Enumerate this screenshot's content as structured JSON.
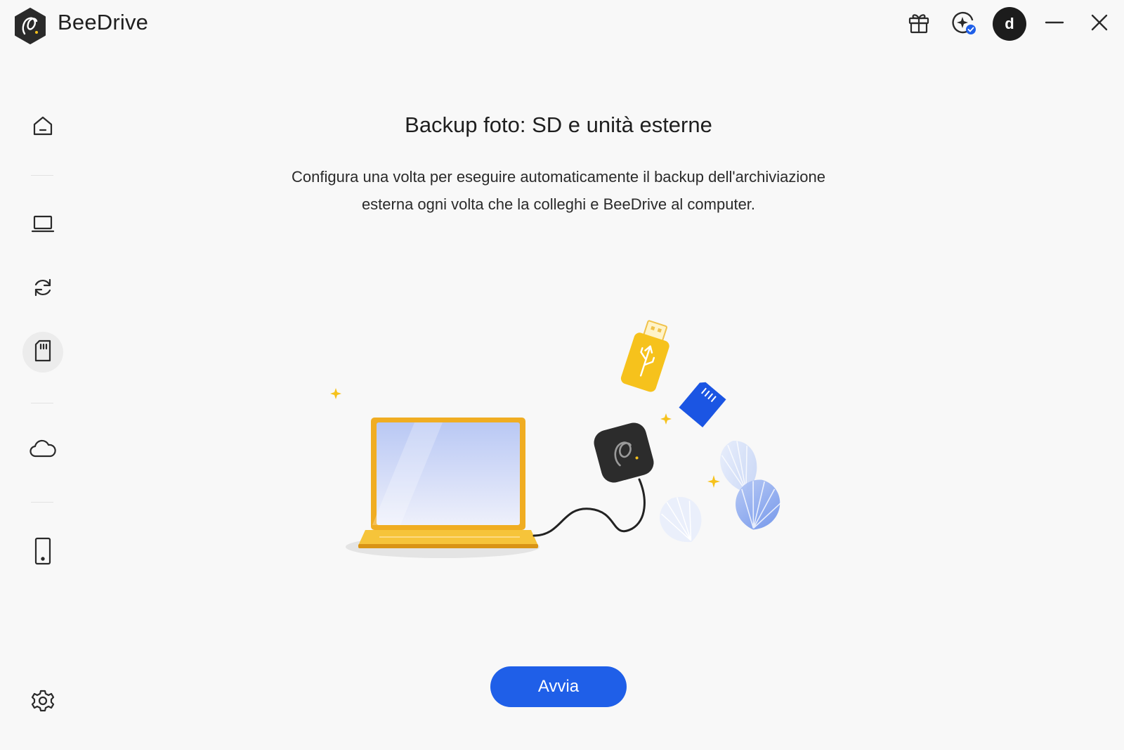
{
  "app": {
    "name": "BeeDrive"
  },
  "header": {
    "avatar_initial": "d",
    "icons": [
      "gift-icon",
      "assistant-sparkle-icon",
      "minimize-icon",
      "close-icon"
    ]
  },
  "sidebar": {
    "items": [
      {
        "icon": "home-icon"
      },
      {
        "icon": "laptop-icon"
      },
      {
        "icon": "sync-icon"
      },
      {
        "icon": "sd-card-icon",
        "active": true
      },
      {
        "icon": "cloud-icon"
      },
      {
        "icon": "phone-icon"
      },
      {
        "icon": "gear-icon"
      }
    ]
  },
  "main": {
    "title": "Backup foto: SD e unità esterne",
    "description_line1": "Configura una volta per eseguire automaticamente il backup dell'archiviazione",
    "description_line2": "esterna ogni volta che la colleghi e BeeDrive al computer.",
    "start_label": "Avvia"
  },
  "colors": {
    "accent": "#1f5fe8",
    "background": "#f8f8f8",
    "laptop": "#f2b01e",
    "usb": "#f6c21c",
    "sd_card": "#1b55e3"
  }
}
